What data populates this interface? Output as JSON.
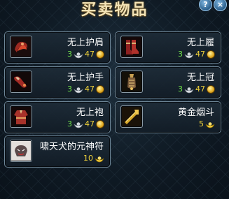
{
  "window": {
    "title": "买卖物品",
    "help_label": "?",
    "close_label": "×"
  },
  "items": [
    {
      "name": "无上护肩",
      "silver": "3",
      "gold": "47",
      "icon": "shoulder-armor-icon"
    },
    {
      "name": "无上履",
      "silver": "3",
      "gold": "47",
      "icon": "boots-icon"
    },
    {
      "name": "无上护手",
      "silver": "3",
      "gold": "47",
      "icon": "gauntlet-icon"
    },
    {
      "name": "无上冠",
      "silver": "3",
      "gold": "47",
      "icon": "crown-icon"
    },
    {
      "name": "无上袍",
      "silver": "3",
      "gold": "47",
      "icon": "robe-icon"
    },
    {
      "name": "黄金烟斗",
      "ingot": "5",
      "icon": "golden-pipe-icon"
    },
    {
      "name": "啸天犬的元神符",
      "ingot": "10",
      "icon": "dog-talisman-icon"
    }
  ],
  "colors": {
    "silver_count": "#6fe04a",
    "ingot_count": "#f0d23a",
    "card_border": "#6d8596"
  }
}
